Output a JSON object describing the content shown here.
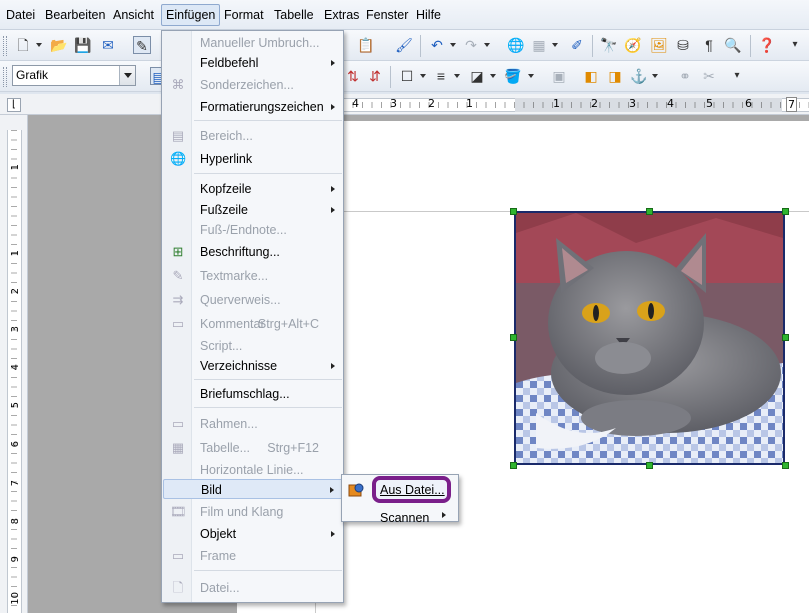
{
  "menubar": {
    "items": [
      {
        "label": "Datei"
      },
      {
        "label": "Bearbeiten"
      },
      {
        "label": "Ansicht"
      },
      {
        "label": "Einfügen"
      },
      {
        "label": "Format"
      },
      {
        "label": "Tabelle"
      },
      {
        "label": "Extras"
      },
      {
        "label": "Fenster"
      },
      {
        "label": "Hilfe"
      }
    ],
    "active": "Einfügen"
  },
  "toolbar2": {
    "style_value": "Grafik"
  },
  "ruler": {
    "h_numbers": [
      "4",
      "3",
      "2",
      "1",
      "1",
      "2",
      "3",
      "4",
      "5",
      "6",
      "7"
    ],
    "v_numbers": [
      "1",
      "1",
      "2",
      "3",
      "4",
      "5",
      "6",
      "7",
      "8",
      "9",
      "10"
    ]
  },
  "insert_menu": {
    "items": [
      {
        "label": "Manueller Umbruch...",
        "disabled": true
      },
      {
        "label": "Feldbefehl",
        "submenu": true
      },
      {
        "label": "Sonderzeichen...",
        "disabled": true,
        "icon": "omega-icon"
      },
      {
        "label": "Formatierungszeichen",
        "submenu": true
      },
      {
        "label": "Bereich...",
        "disabled": true,
        "icon": "section-icon"
      },
      {
        "label": "Hyperlink",
        "icon": "hyperlink-icon"
      },
      {
        "label": "Kopfzeile",
        "submenu": true
      },
      {
        "label": "Fußzeile",
        "submenu": true
      },
      {
        "label": "Fuß-/Endnote...",
        "disabled": true
      },
      {
        "label": "Beschriftung...",
        "icon": "caption-icon"
      },
      {
        "label": "Textmarke...",
        "disabled": true,
        "icon": "bookmark-icon"
      },
      {
        "label": "Querverweis...",
        "disabled": true,
        "icon": "cross-reference-icon"
      },
      {
        "label": "Kommentar",
        "accel": "Strg+Alt+C",
        "disabled": true,
        "icon": "comment-icon"
      },
      {
        "label": "Script...",
        "disabled": true
      },
      {
        "label": "Verzeichnisse",
        "submenu": true
      },
      {
        "label": "Briefumschlag..."
      },
      {
        "label": "Rahmen...",
        "disabled": true,
        "icon": "frame-icon"
      },
      {
        "label": "Tabelle...",
        "accel": "Strg+F12",
        "disabled": true,
        "icon": "table-icon"
      },
      {
        "label": "Horizontale Linie...",
        "disabled": true
      },
      {
        "label": "Bild",
        "submenu": true,
        "highlighted": true
      },
      {
        "label": "Film und Klang",
        "disabled": true,
        "icon": "movie-icon"
      },
      {
        "label": "Objekt",
        "submenu": true
      },
      {
        "label": "Frame",
        "disabled": true,
        "icon": "floating-frame-icon"
      },
      {
        "label": "Datei...",
        "disabled": true,
        "icon": "file-icon"
      }
    ]
  },
  "bild_submenu": {
    "items": [
      {
        "label": "Aus Datei...",
        "highlighted": true,
        "icon": "image-from-file-icon"
      },
      {
        "label": "Scannen",
        "submenu": true
      }
    ]
  },
  "image": {
    "alt": "Graue Katze (Kartäuser) auf blau-weiß kariertem Stoff"
  },
  "colors": {
    "highlight_ring": "#7a1f8a",
    "handle": "#2fb52f",
    "image_border": "#1a2a6a"
  }
}
